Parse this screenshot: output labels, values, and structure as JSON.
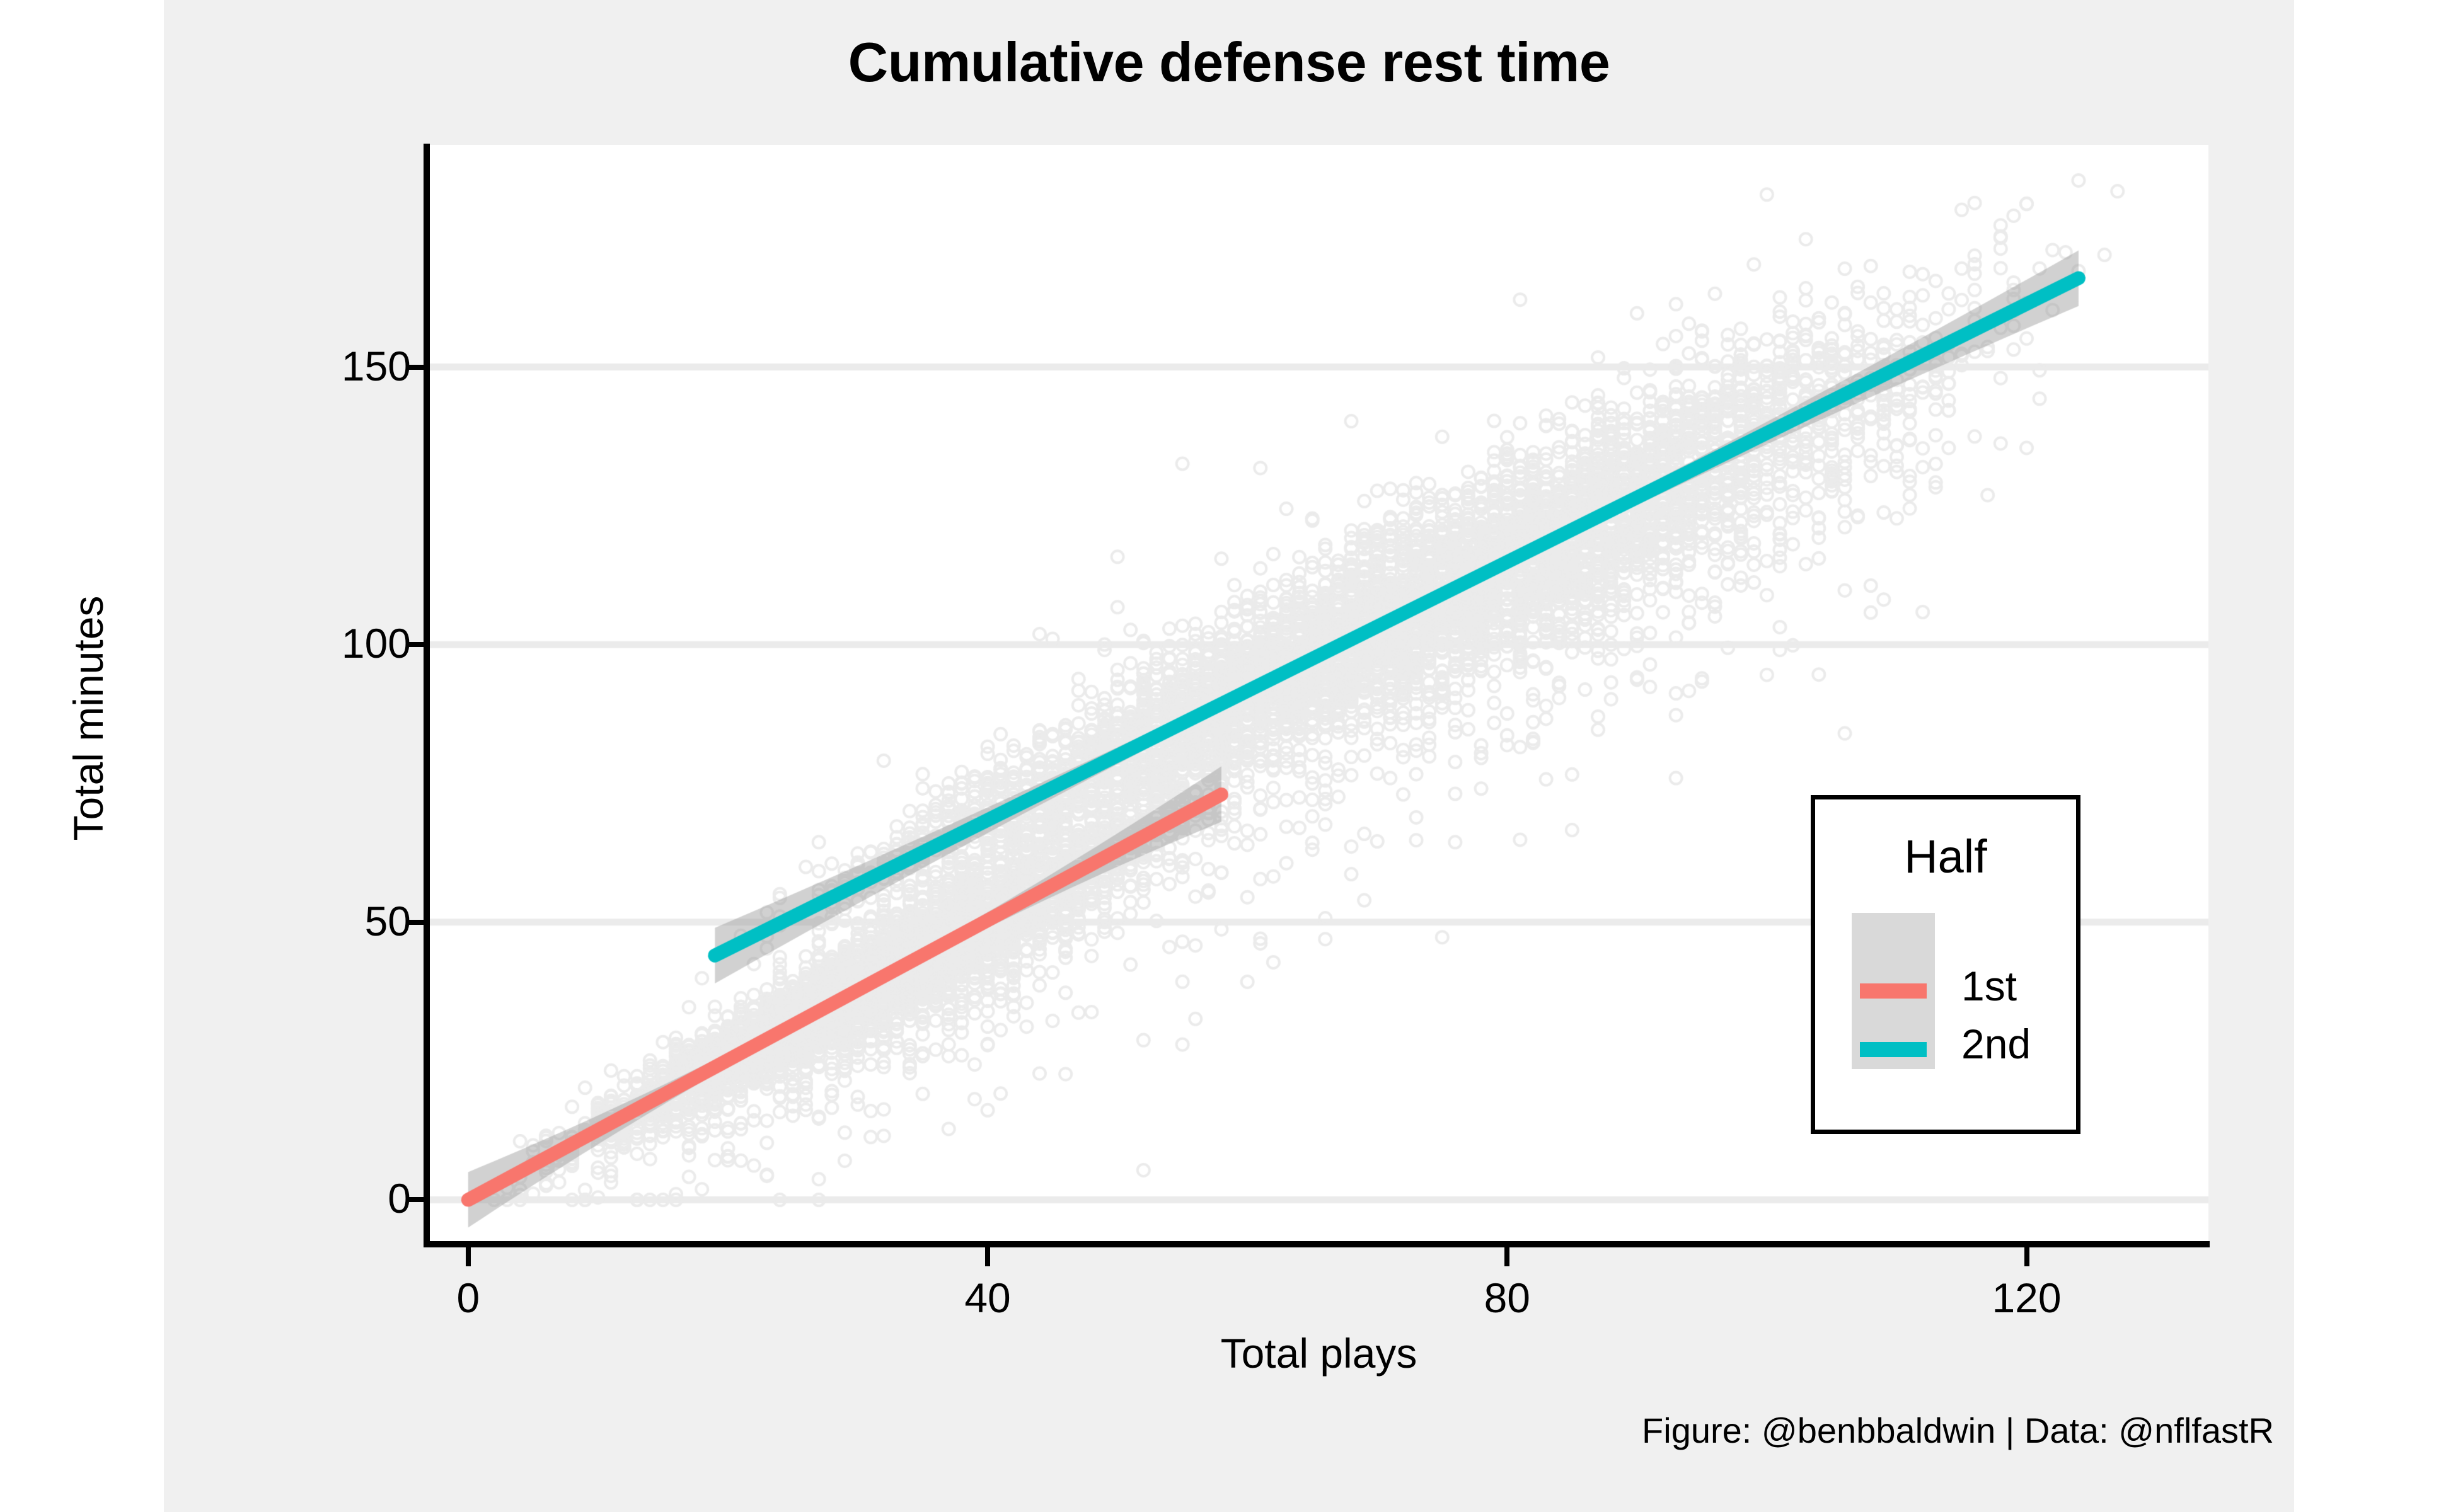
{
  "figure": {
    "title": "Cumulative defense rest time",
    "caption": "Figure: @benbbaldwin | Data: @nflfastR",
    "background_color": "#F0F0F0",
    "panel_color": "#FFFFFF"
  },
  "legend": {
    "title": "Half",
    "entries": [
      {
        "label": "1st",
        "color": "#F8766D"
      },
      {
        "label": "2nd",
        "color": "#00BFC4"
      }
    ],
    "key_background": "#D9D9D9"
  },
  "axes": {
    "x": {
      "label": "Total plays",
      "ticks": [
        0,
        40,
        80,
        120
      ],
      "tick_labels": [
        "0",
        "40",
        "80",
        "120"
      ],
      "min": -3,
      "max": 134
    },
    "y": {
      "label": "Total minutes",
      "ticks": [
        0,
        50,
        100,
        150
      ],
      "tick_labels": [
        "0",
        "50",
        "100",
        "150"
      ],
      "min": -8,
      "max": 190
    },
    "grid_color": "#EBEBEB"
  },
  "chart_data": {
    "type": "scatter",
    "title": "Cumulative defense rest time",
    "xlabel": "Total plays",
    "ylabel": "Total minutes",
    "xlim": [
      -3,
      134
    ],
    "ylim": [
      -8,
      190
    ],
    "xticks": [
      0,
      40,
      80,
      120
    ],
    "yticks": [
      0,
      50,
      100,
      150
    ],
    "grid": true,
    "legend_position": "inside-right",
    "legend_title": "Half",
    "point_shape": "open-circle",
    "point_alpha": 0.1,
    "series": [
      {
        "name": "1st",
        "color": "#F8766D",
        "n_points": 4200,
        "x_range": [
          0,
          62
        ],
        "y_range": [
          0,
          80
        ],
        "fit": {
          "type": "linear",
          "x_start": 0,
          "y_start": 0,
          "x_end": 58,
          "y_end": 73,
          "slope": 1.26,
          "intercept": 0.0,
          "se_band": true,
          "se_color": "#BFBFBF"
        },
        "scatter_sd": 6.0
      },
      {
        "name": "2nd",
        "color": "#00BFC4",
        "n_points": 6200,
        "x_range": [
          18,
          128
        ],
        "y_range": [
          40,
          182
        ],
        "fit": {
          "type": "linear",
          "x_start": 19,
          "y_start": 44,
          "x_end": 124,
          "y_end": 166,
          "slope": 1.162,
          "intercept": 21.9,
          "se_band": true,
          "se_color": "#BFBFBF"
        },
        "scatter_sd": 11.0
      }
    ]
  }
}
